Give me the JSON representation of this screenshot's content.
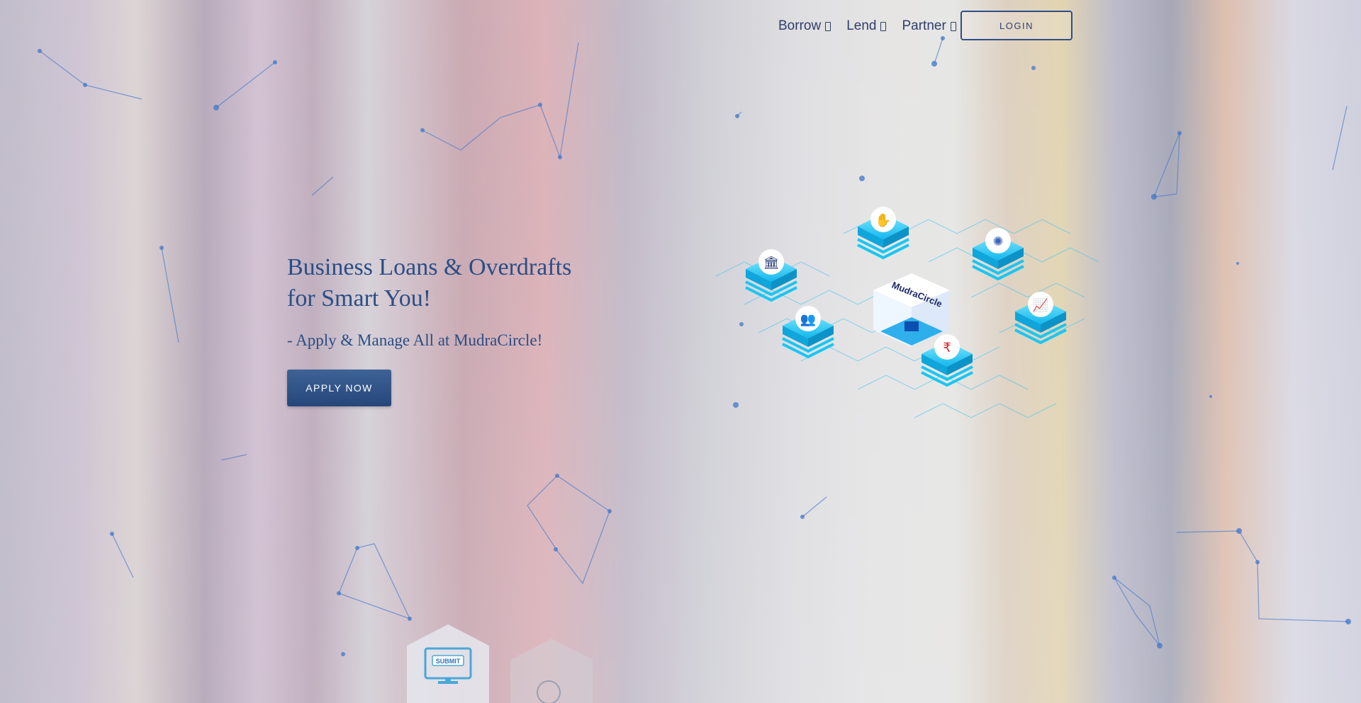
{
  "nav": {
    "items": [
      {
        "label": "Borrow"
      },
      {
        "label": "Lend"
      },
      {
        "label": "Partner"
      }
    ],
    "login_label": "LOGIN"
  },
  "hero": {
    "title_line1": "Business Loans & Overdrafts",
    "title_line2": "for Smart You!",
    "subtitle": "- Apply & Manage All at MudraCircle!",
    "cta_label": "APPLY NOW"
  },
  "illustration": {
    "center_logo_text": "MudraCircle",
    "tiles": [
      {
        "icon": "handshake-icon"
      },
      {
        "icon": "bank-icon"
      },
      {
        "icon": "virus-icon"
      },
      {
        "icon": "people-icon"
      },
      {
        "icon": "growth-chart-icon"
      },
      {
        "icon": "rupee-icon"
      }
    ]
  },
  "bottom_hex": {
    "submit_label": "SUBMIT"
  },
  "colors": {
    "primary": "#2a4e86",
    "accent_cyan": "#19c6f2",
    "button": "#2f5186"
  }
}
